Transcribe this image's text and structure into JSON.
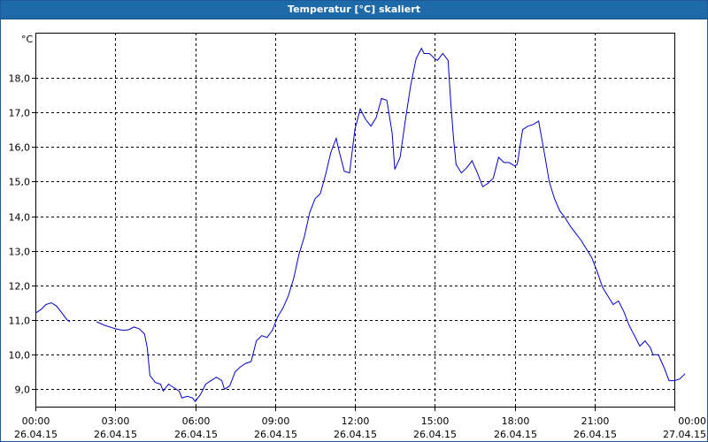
{
  "window": {
    "title": "Temperatur [°C] skaliert"
  },
  "chart_data": {
    "type": "line",
    "title": "Temperatur [°C] skaliert",
    "ylabel": "°C",
    "xlabel": "",
    "ylim": [
      8.5,
      19.3
    ],
    "xlim": [
      0,
      24
    ],
    "grid": true,
    "line_color": "#0000cc",
    "y_ticks": [
      {
        "value": 9.0,
        "label": "9,0"
      },
      {
        "value": 10.0,
        "label": "10,0"
      },
      {
        "value": 11.0,
        "label": "11,0"
      },
      {
        "value": 12.0,
        "label": "12,0"
      },
      {
        "value": 13.0,
        "label": "13,0"
      },
      {
        "value": 14.0,
        "label": "14,0"
      },
      {
        "value": 15.0,
        "label": "15,0"
      },
      {
        "value": 16.0,
        "label": "16,0"
      },
      {
        "value": 17.0,
        "label": "17,0"
      },
      {
        "value": 18.0,
        "label": "18,0"
      }
    ],
    "x_ticks": [
      {
        "value": 0,
        "time": "00:00",
        "date": "26.04.15"
      },
      {
        "value": 3,
        "time": "03:00",
        "date": "26.04.15"
      },
      {
        "value": 6,
        "time": "06:00",
        "date": "26.04.15"
      },
      {
        "value": 9,
        "time": "09:00",
        "date": "26.04.15"
      },
      {
        "value": 12,
        "time": "12:00",
        "date": "26.04.15"
      },
      {
        "value": 15,
        "time": "15:00",
        "date": "26.04.15"
      },
      {
        "value": 18,
        "time": "18:00",
        "date": "26.04.15"
      },
      {
        "value": 21,
        "time": "21:00",
        "date": "26.04.15"
      },
      {
        "value": 24,
        "time": "00:00",
        "date": "27.04.15"
      }
    ],
    "series": [
      {
        "segments": [
          [
            [
              0.0,
              11.2
            ],
            [
              0.2,
              11.3
            ],
            [
              0.4,
              11.45
            ],
            [
              0.6,
              11.5
            ],
            [
              0.8,
              11.4
            ],
            [
              1.0,
              11.2
            ],
            [
              1.2,
              11.0
            ],
            [
              1.3,
              10.95
            ]
          ],
          [
            [
              2.3,
              10.95
            ],
            [
              2.6,
              10.85
            ],
            [
              3.0,
              10.75
            ],
            [
              3.3,
              10.7
            ],
            [
              3.5,
              10.72
            ],
            [
              3.7,
              10.8
            ],
            [
              3.9,
              10.75
            ],
            [
              4.1,
              10.6
            ],
            [
              4.2,
              10.2
            ],
            [
              4.3,
              9.4
            ],
            [
              4.5,
              9.2
            ],
            [
              4.7,
              9.15
            ],
            [
              4.8,
              8.95
            ],
            [
              5.0,
              9.15
            ],
            [
              5.2,
              9.05
            ],
            [
              5.4,
              8.95
            ],
            [
              5.5,
              8.75
            ],
            [
              5.7,
              8.8
            ],
            [
              5.9,
              8.75
            ],
            [
              6.0,
              8.65
            ],
            [
              6.2,
              8.85
            ],
            [
              6.4,
              9.15
            ],
            [
              6.6,
              9.25
            ],
            [
              6.8,
              9.35
            ],
            [
              7.0,
              9.25
            ],
            [
              7.1,
              9.0
            ],
            [
              7.3,
              9.1
            ],
            [
              7.5,
              9.5
            ],
            [
              7.7,
              9.65
            ],
            [
              7.9,
              9.75
            ],
            [
              8.1,
              9.8
            ],
            [
              8.3,
              10.4
            ],
            [
              8.5,
              10.55
            ],
            [
              8.7,
              10.5
            ],
            [
              8.9,
              10.7
            ],
            [
              9.1,
              11.1
            ],
            [
              9.3,
              11.35
            ],
            [
              9.5,
              11.7
            ],
            [
              9.7,
              12.2
            ],
            [
              9.9,
              12.9
            ],
            [
              10.1,
              13.4
            ],
            [
              10.3,
              14.1
            ],
            [
              10.5,
              14.5
            ],
            [
              10.7,
              14.65
            ],
            [
              10.9,
              15.2
            ],
            [
              11.1,
              15.85
            ],
            [
              11.3,
              16.25
            ],
            [
              11.4,
              15.9
            ],
            [
              11.6,
              15.3
            ],
            [
              11.8,
              15.25
            ],
            [
              12.0,
              16.5
            ],
            [
              12.2,
              17.1
            ],
            [
              12.4,
              16.8
            ],
            [
              12.6,
              16.6
            ],
            [
              12.8,
              16.85
            ],
            [
              13.0,
              17.4
            ],
            [
              13.2,
              17.35
            ],
            [
              13.4,
              16.4
            ],
            [
              13.5,
              15.35
            ],
            [
              13.7,
              15.7
            ],
            [
              13.9,
              16.8
            ],
            [
              14.1,
              17.8
            ],
            [
              14.3,
              18.55
            ],
            [
              14.5,
              18.85
            ],
            [
              14.6,
              18.7
            ],
            [
              14.8,
              18.7
            ],
            [
              15.0,
              18.55
            ],
            [
              15.1,
              18.5
            ],
            [
              15.3,
              18.7
            ],
            [
              15.5,
              18.5
            ],
            [
              15.6,
              17.3
            ],
            [
              15.7,
              16.3
            ],
            [
              15.8,
              15.5
            ],
            [
              16.0,
              15.25
            ],
            [
              16.2,
              15.4
            ],
            [
              16.4,
              15.6
            ],
            [
              16.6,
              15.25
            ],
            [
              16.8,
              14.85
            ],
            [
              17.0,
              14.95
            ],
            [
              17.2,
              15.1
            ],
            [
              17.4,
              15.7
            ],
            [
              17.6,
              15.55
            ],
            [
              17.8,
              15.55
            ],
            [
              18.0,
              15.45
            ],
            [
              18.1,
              15.5
            ],
            [
              18.3,
              16.5
            ],
            [
              18.5,
              16.6
            ],
            [
              18.7,
              16.65
            ],
            [
              18.9,
              16.75
            ],
            [
              19.1,
              15.9
            ],
            [
              19.3,
              15.0
            ],
            [
              19.5,
              14.5
            ],
            [
              19.7,
              14.15
            ],
            [
              19.9,
              13.95
            ],
            [
              20.1,
              13.7
            ],
            [
              20.3,
              13.5
            ],
            [
              20.5,
              13.3
            ],
            [
              20.7,
              13.05
            ],
            [
              20.9,
              12.8
            ],
            [
              21.1,
              12.4
            ],
            [
              21.3,
              11.95
            ],
            [
              21.5,
              11.7
            ],
            [
              21.7,
              11.45
            ],
            [
              21.9,
              11.55
            ],
            [
              22.1,
              11.25
            ],
            [
              22.3,
              10.85
            ],
            [
              22.5,
              10.55
            ],
            [
              22.7,
              10.25
            ],
            [
              22.9,
              10.4
            ],
            [
              23.1,
              10.2
            ],
            [
              23.2,
              10.0
            ],
            [
              23.4,
              10.0
            ],
            [
              23.6,
              9.65
            ],
            [
              23.8,
              9.25
            ],
            [
              24.0,
              9.25
            ],
            [
              24.2,
              9.3
            ],
            [
              24.4,
              9.45
            ]
          ]
        ]
      }
    ]
  }
}
